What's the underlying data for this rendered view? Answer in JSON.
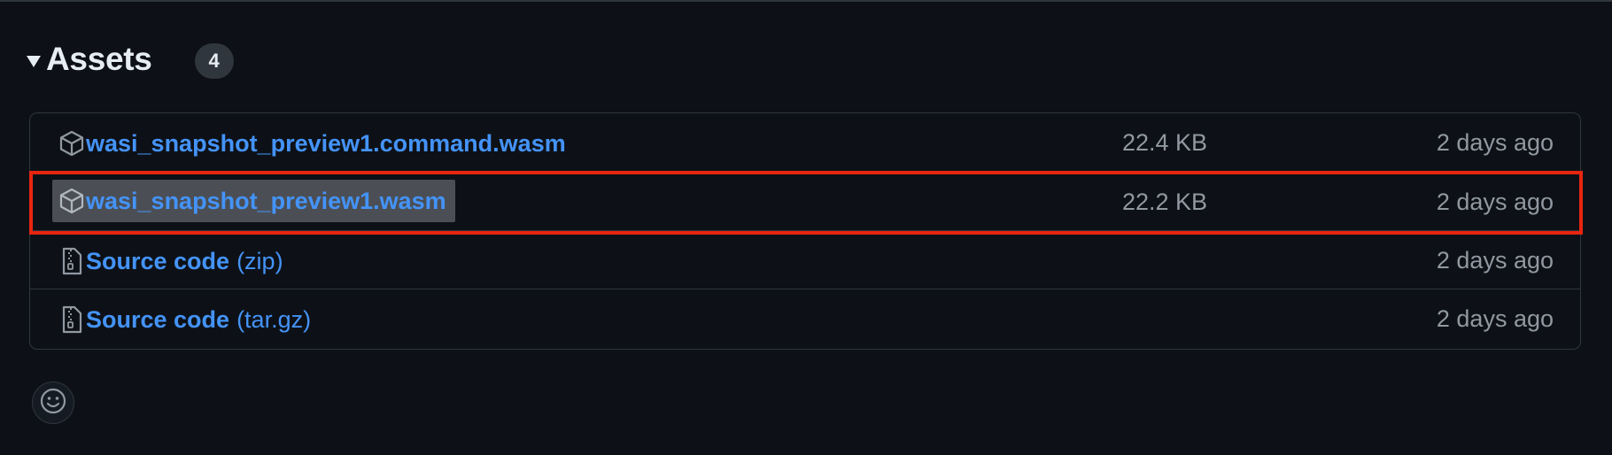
{
  "assets": {
    "title": "Assets",
    "count": "4",
    "rows": [
      {
        "name": "wasi_snapshot_preview1.command.wasm",
        "suffix": "",
        "size": "22.4 KB",
        "date": "2 days ago",
        "icon": "package-icon",
        "selected": false
      },
      {
        "name": "wasi_snapshot_preview1.wasm",
        "suffix": "",
        "size": "22.2 KB",
        "date": "2 days ago",
        "icon": "package-icon",
        "selected": true
      },
      {
        "name": "Source code",
        "suffix": "(zip)",
        "size": "",
        "date": "2 days ago",
        "icon": "file-zip-icon",
        "selected": false
      },
      {
        "name": "Source code",
        "suffix": "(tar.gz)",
        "size": "",
        "date": "2 days ago",
        "icon": "file-zip-icon",
        "selected": false
      }
    ]
  },
  "reactions": {
    "icon": "smiley-icon"
  },
  "colors": {
    "background": "#0d1117",
    "link": "#4493f8",
    "muted_text": "#9198a1",
    "border": "#30363d",
    "highlight": "#e8250f",
    "selection": "#4b4f55"
  }
}
